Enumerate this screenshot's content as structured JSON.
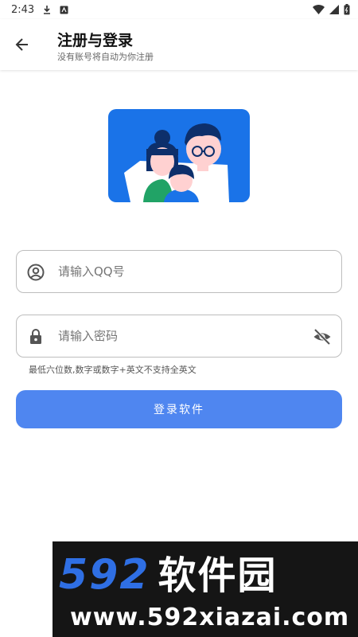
{
  "status_bar": {
    "time": "2:43"
  },
  "header": {
    "title": "注册与登录",
    "subtitle": "没有账号将自动为你注册"
  },
  "form": {
    "qq_field": {
      "placeholder": "请输入QQ号",
      "icon": "account-circle-icon"
    },
    "password_field": {
      "placeholder": "请输入密码",
      "icon": "lock-icon",
      "toggle_icon": "visibility-off-icon"
    },
    "hint": "最低六位数,数字或数字+英文不支持全英文",
    "submit_label": "登录软件"
  },
  "watermark": {
    "logo_num": "592",
    "logo_cn": "软件园",
    "url": "www.592xiazai.com"
  },
  "colors": {
    "accent": "#4f86f0",
    "illustration_bg": "#1a73e8",
    "watermark_bg": "#151515",
    "watermark_blue": "#2f6fe4"
  }
}
